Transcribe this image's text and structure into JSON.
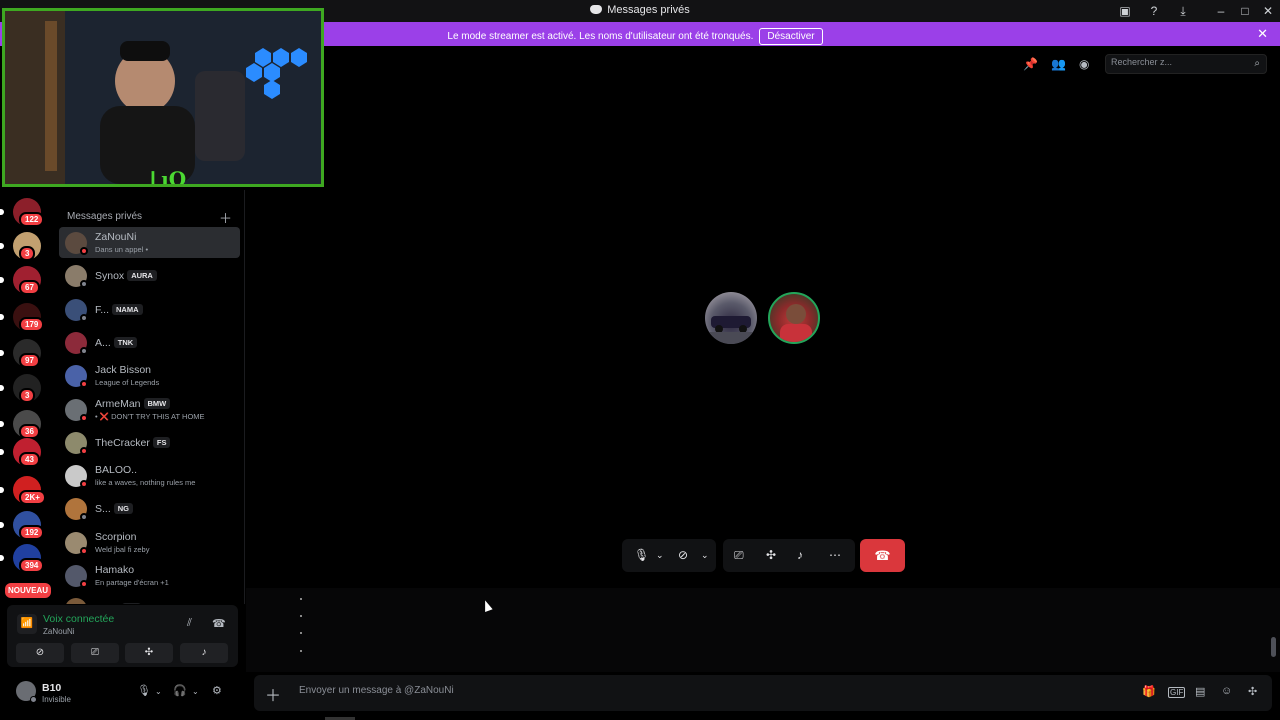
{
  "window": {
    "title": "Messages privés"
  },
  "banner": {
    "message": "Le mode streamer est activé. Les noms d'utilisateur ont été tronqués.",
    "button": "Désactiver"
  },
  "servers": {
    "badges": [
      "122",
      "3",
      "67",
      "179",
      "97",
      "3",
      "36",
      "43",
      "2K+",
      "192",
      "394"
    ],
    "new_label": "NOUVEAU"
  },
  "dm": {
    "header": "Messages privés",
    "items": [
      {
        "name": "ZaNouNi",
        "sub": "Dans un appel •",
        "tag": "",
        "status": "#f23f43",
        "avatar": "#5b4a3f"
      },
      {
        "name": "Synox",
        "sub": "",
        "tag": "AURA",
        "status": "#80848e",
        "avatar": "#8a7c6a"
      },
      {
        "name": "F...",
        "sub": "",
        "tag": "NAMA",
        "status": "#80848e",
        "avatar": "#3a4f78"
      },
      {
        "name": "A...",
        "sub": "",
        "tag": "TNK",
        "status": "#80848e",
        "avatar": "#8c2a3a"
      },
      {
        "name": "Jack Bisson",
        "sub": "League of Legends",
        "tag": "",
        "status": "#f23f43",
        "avatar": "#4a62a8"
      },
      {
        "name": "ArmeMan",
        "sub": "• ❌ DON'T TRY THIS AT HOME",
        "tag": "BMW",
        "status": "#f23f43",
        "avatar": "#6a6f74"
      },
      {
        "name": "TheCracker",
        "sub": "",
        "tag": "FS",
        "status": "#f23f43",
        "avatar": "#8d8a6c"
      },
      {
        "name": "BALOO..",
        "sub": "like a waves, nothing rules me",
        "tag": "",
        "status": "#f23f43",
        "avatar": "#c9c9c9"
      },
      {
        "name": "S...",
        "sub": "",
        "tag": "NG",
        "status": "#80848e",
        "avatar": "#b0743c"
      },
      {
        "name": "Scorpion",
        "sub": "Weld jbal fi zeby",
        "tag": "",
        "status": "#f23f43",
        "avatar": "#9a8a70"
      },
      {
        "name": "Hamako",
        "sub": "En partage d'écran +1",
        "tag": "",
        "status": "#f23f43",
        "avatar": "#53586a"
      },
      {
        "name": "Enze",
        "sub": "",
        "tag": "NG",
        "status": "#80848e",
        "avatar": "#7a5a3a"
      }
    ]
  },
  "voice": {
    "status": "Voix connectée",
    "channel": "ZaNouNi"
  },
  "user": {
    "name": "B10",
    "status": "Invisible"
  },
  "cam": {
    "logo": "ᒪıO"
  },
  "search": {
    "placeholder": "Rechercher z..."
  },
  "composer": {
    "placeholder": "Envoyer un message à @ZaNouNi"
  },
  "icons": {
    "window_controls": [
      "cast-icon",
      "help-icon",
      "download-icon",
      "minimize-icon",
      "maximize-icon",
      "close-icon"
    ],
    "header_tools": [
      "pin-icon",
      "add-friend-icon",
      "profile-icon"
    ],
    "call_controls": [
      "microphone-icon",
      "camera-off-icon",
      "screen-share-icon",
      "activities-icon",
      "soundboard-icon",
      "more-icon",
      "hang-up-icon"
    ],
    "composer_tools": [
      "gift-icon",
      "gif-icon",
      "sticker-icon",
      "emoji-icon",
      "apps-icon"
    ]
  },
  "colors": {
    "banner": "#9b40e8",
    "voice_connected": "#23a55a",
    "hangup": "#da373c",
    "cam_border": "#3ea821"
  }
}
